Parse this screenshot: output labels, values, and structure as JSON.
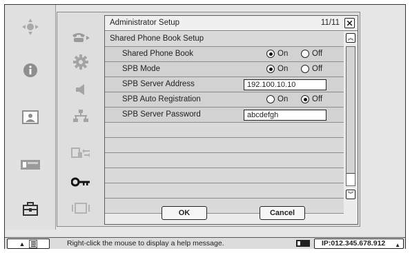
{
  "left_column": {
    "icons": [
      "camera-control-icon",
      "info-icon",
      "picture-icon",
      "card-icon",
      "toolbox-icon"
    ]
  },
  "category_column": {
    "icons": [
      "phone-icon",
      "gear-icon",
      "speaker-icon",
      "network-icon",
      "connection-icon",
      "key-icon",
      "screen-icon"
    ]
  },
  "dialog": {
    "title": "Administrator Setup",
    "page": "11/11",
    "section_title": "Shared Phone Book Setup",
    "items": [
      {
        "label": "Shared Phone Book",
        "type": "radio",
        "options": [
          "On",
          "Off"
        ],
        "selected": "On"
      },
      {
        "label": "SPB Mode",
        "type": "radio",
        "options": [
          "On",
          "Off"
        ],
        "selected": "On"
      },
      {
        "label": "SPB Server Address",
        "type": "text",
        "value": "192.100.10.10"
      },
      {
        "label": "SPB Auto Registration",
        "type": "radio",
        "options": [
          "On",
          "Off"
        ],
        "selected": "Off"
      },
      {
        "label": "SPB Server Password",
        "type": "text",
        "value": "abcdefgh"
      }
    ],
    "ok_label": "OK",
    "cancel_label": "Cancel"
  },
  "status_bar": {
    "help_text": "Right-click the mouse to display a help message.",
    "ip_text": "IP:012.345.678.912"
  }
}
